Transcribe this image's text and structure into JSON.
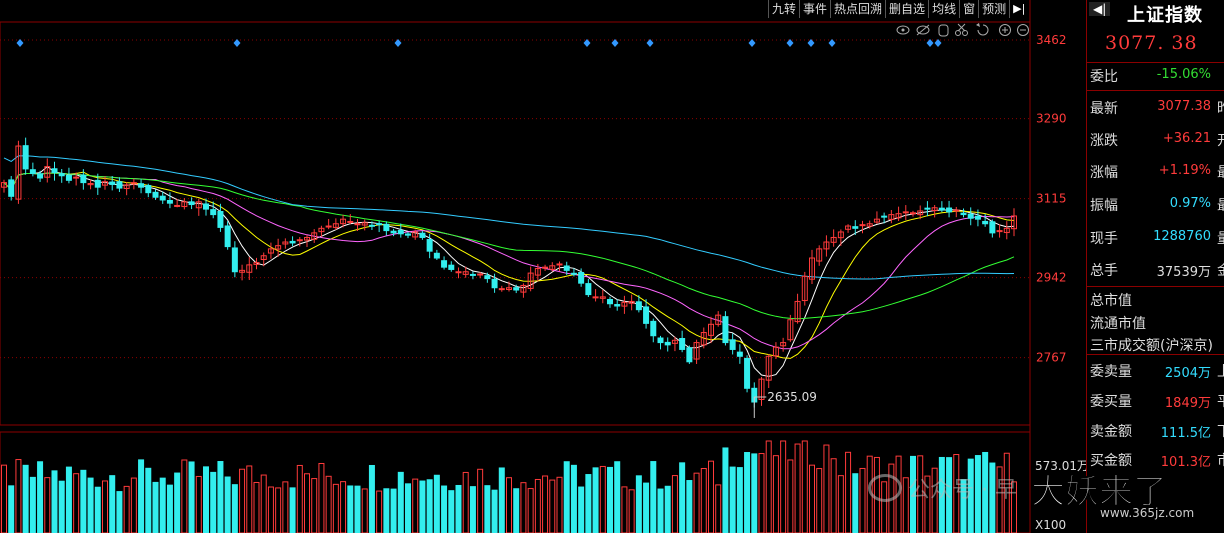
{
  "toolbar": {
    "items": [
      "九转",
      "事件",
      "热点回溯",
      "删自选",
      "均线",
      "窗",
      "预测"
    ],
    "arrow": "▶|"
  },
  "panel": {
    "back": "◀|",
    "title": "上证指数",
    "price": "3077. 38",
    "rows": [
      {
        "label": "委比",
        "value": "-15.06%",
        "color": "#33dd33",
        "tail": ""
      },
      {
        "label": "最新",
        "value": "3077.38",
        "color": "#ff3b3b",
        "tail": "昨"
      },
      {
        "label": "涨跌",
        "value": "+36.21",
        "color": "#ff3b3b",
        "tail": "开"
      },
      {
        "label": "涨幅",
        "value": "+1.19%",
        "color": "#ff3b3b",
        "tail": "最"
      },
      {
        "label": "振幅",
        "value": "0.97%",
        "color": "#33ddff",
        "tail": "最"
      },
      {
        "label": "现手",
        "value": "1288760",
        "color": "#33ddff",
        "tail": "量"
      },
      {
        "label": "总手",
        "value": "37539万",
        "color": "#dddddd",
        "tail": "金"
      }
    ],
    "market": [
      "总市值",
      "流通市值",
      "三市成交额(沪深京)"
    ],
    "orders": [
      {
        "label": "委卖量",
        "value": "2504万",
        "color": "#33ddff",
        "tail": "上"
      },
      {
        "label": "委买量",
        "value": "1849万",
        "color": "#ff3b3b",
        "tail": "平"
      },
      {
        "label": "卖金额",
        "value": "111.5亿",
        "color": "#33ddff",
        "tail": "下"
      },
      {
        "label": "买金额",
        "value": "101.3亿",
        "color": "#ff3b3b",
        "tail": "市"
      }
    ]
  },
  "watermark": {
    "account": "公众号 · 早",
    "brand": "大妖来了",
    "site": "www.365jz.com"
  },
  "chart_data": {
    "type": "candlestick",
    "price_axis": {
      "ticks": [
        3462,
        3290,
        3115,
        2942,
        2767
      ],
      "range": [
        2600,
        3480
      ]
    },
    "annotation": "2635.09",
    "low": 2635.09,
    "close": 3077.38,
    "volume_axis": {
      "ticks": [
        "573.01万"
      ],
      "unit": "X100"
    },
    "colors": {
      "up": "#ff3b3b",
      "down": "#33eeee",
      "ma5": "#ffffff",
      "ma10": "#ffff00",
      "ma20": "#ff66ff",
      "ma60": "#33ff33",
      "ma120": "#33ccff"
    },
    "closes": [
      3150,
      3120,
      3230,
      3180,
      3170,
      3160,
      3185,
      3172,
      3165,
      3155,
      3162,
      3150,
      3148,
      3140,
      3152,
      3146,
      3138,
      3145,
      3150,
      3140,
      3128,
      3118,
      3112,
      3105,
      3100,
      3108,
      3102,
      3108,
      3092,
      3080,
      3052,
      3010,
      2955,
      2958,
      2970,
      2975,
      2990,
      3005,
      3012,
      3020,
      3018,
      3025,
      3030,
      3040,
      3050,
      3055,
      3060,
      3070,
      3065,
      3060,
      3062,
      3056,
      3058,
      3045,
      3040,
      3038,
      3035,
      3042,
      3030,
      3000,
      2985,
      2965,
      2960,
      2955,
      2955,
      2948,
      2950,
      2940,
      2920,
      2918,
      2920,
      2915,
      2925,
      2952,
      2962,
      2965,
      2968,
      2972,
      2958,
      2950,
      2930,
      2905,
      2900,
      2900,
      2885,
      2880,
      2888,
      2890,
      2872,
      2842,
      2815,
      2800,
      2795,
      2805,
      2785,
      2758,
      2800,
      2822,
      2840,
      2860,
      2800,
      2785,
      2770,
      2700,
      2670,
      2720,
      2770,
      2790,
      2800,
      2850,
      2890,
      2945,
      2985,
      3005,
      3020,
      3030,
      3042,
      3055,
      3050,
      3058,
      3060,
      3070,
      3075,
      3080,
      3082,
      3086,
      3084,
      3088,
      3092,
      3095,
      3090,
      3086,
      3090,
      3080,
      3072,
      3070,
      3060,
      3040,
      3045,
      3050,
      3077
    ]
  }
}
